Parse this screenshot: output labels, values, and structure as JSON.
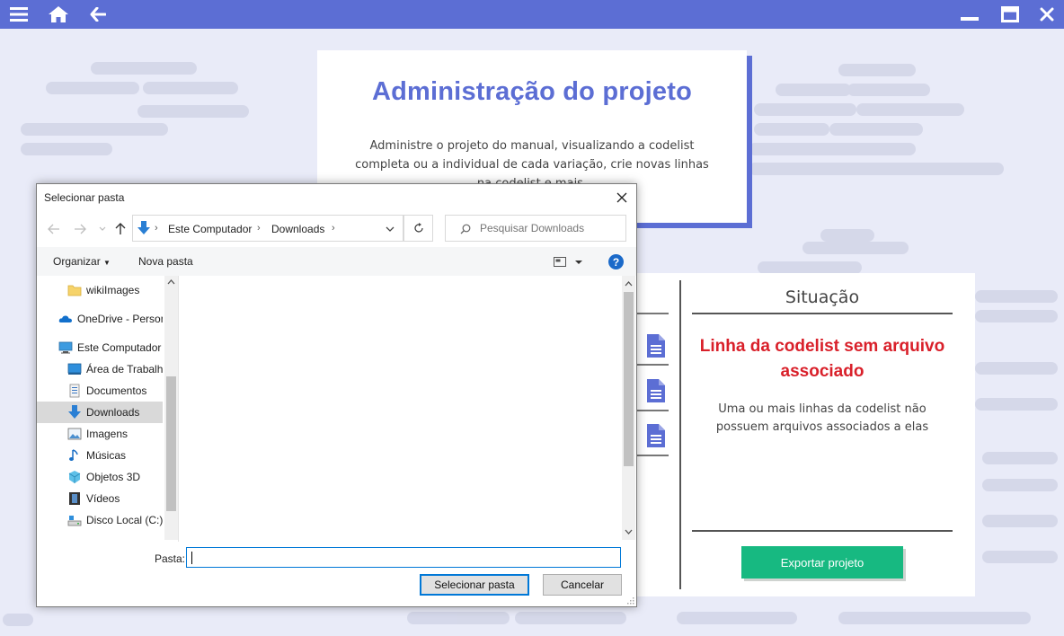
{
  "colors": {
    "accent": "#5c6ed4",
    "background": "#e9ebf8",
    "status_error": "#d9202a",
    "export_button": "#17b981"
  },
  "topbar": {
    "icons": [
      "menu-icon",
      "home-icon",
      "back-arrow-icon",
      "minimize-icon",
      "maximize-icon",
      "close-icon"
    ]
  },
  "admin": {
    "title": "Administração do projeto",
    "description": "Administre o projeto do manual, visualizando a codelist completa ou a individual de cada variação, crie novas linhas na codelist e mais."
  },
  "situation": {
    "heading": "Situação",
    "status": "Linha da codelist sem arquivo associado",
    "message": "Uma ou mais linhas da codelist não possuem arquivos associados a elas",
    "export_label": "Exportar projeto"
  },
  "dialog": {
    "title": "Selecionar pasta",
    "address": {
      "crumbs": [
        "Este Computador",
        "Downloads"
      ]
    },
    "search_placeholder": "Pesquisar Downloads",
    "toolbar": {
      "organize": "Organizar",
      "new_folder": "Nova pasta"
    },
    "tree": [
      {
        "label": "wikiImages",
        "icon": "folder-icon"
      },
      {
        "label": "OneDrive - Personal",
        "icon": "onedrive-icon"
      },
      {
        "label": "Este Computador",
        "icon": "computer-icon"
      },
      {
        "label": "Área de Trabalho",
        "icon": "desktop-icon"
      },
      {
        "label": "Documentos",
        "icon": "documents-icon"
      },
      {
        "label": "Downloads",
        "icon": "downloads-icon",
        "selected": true
      },
      {
        "label": "Imagens",
        "icon": "pictures-icon"
      },
      {
        "label": "Músicas",
        "icon": "music-icon"
      },
      {
        "label": "Objetos 3D",
        "icon": "objects-3d-icon"
      },
      {
        "label": "Vídeos",
        "icon": "videos-icon"
      },
      {
        "label": "Disco Local (C:)",
        "icon": "drive-icon"
      }
    ],
    "folder_label": "Pasta:",
    "folder_value": "",
    "select_label": "Selecionar pasta",
    "cancel_label": "Cancelar"
  }
}
